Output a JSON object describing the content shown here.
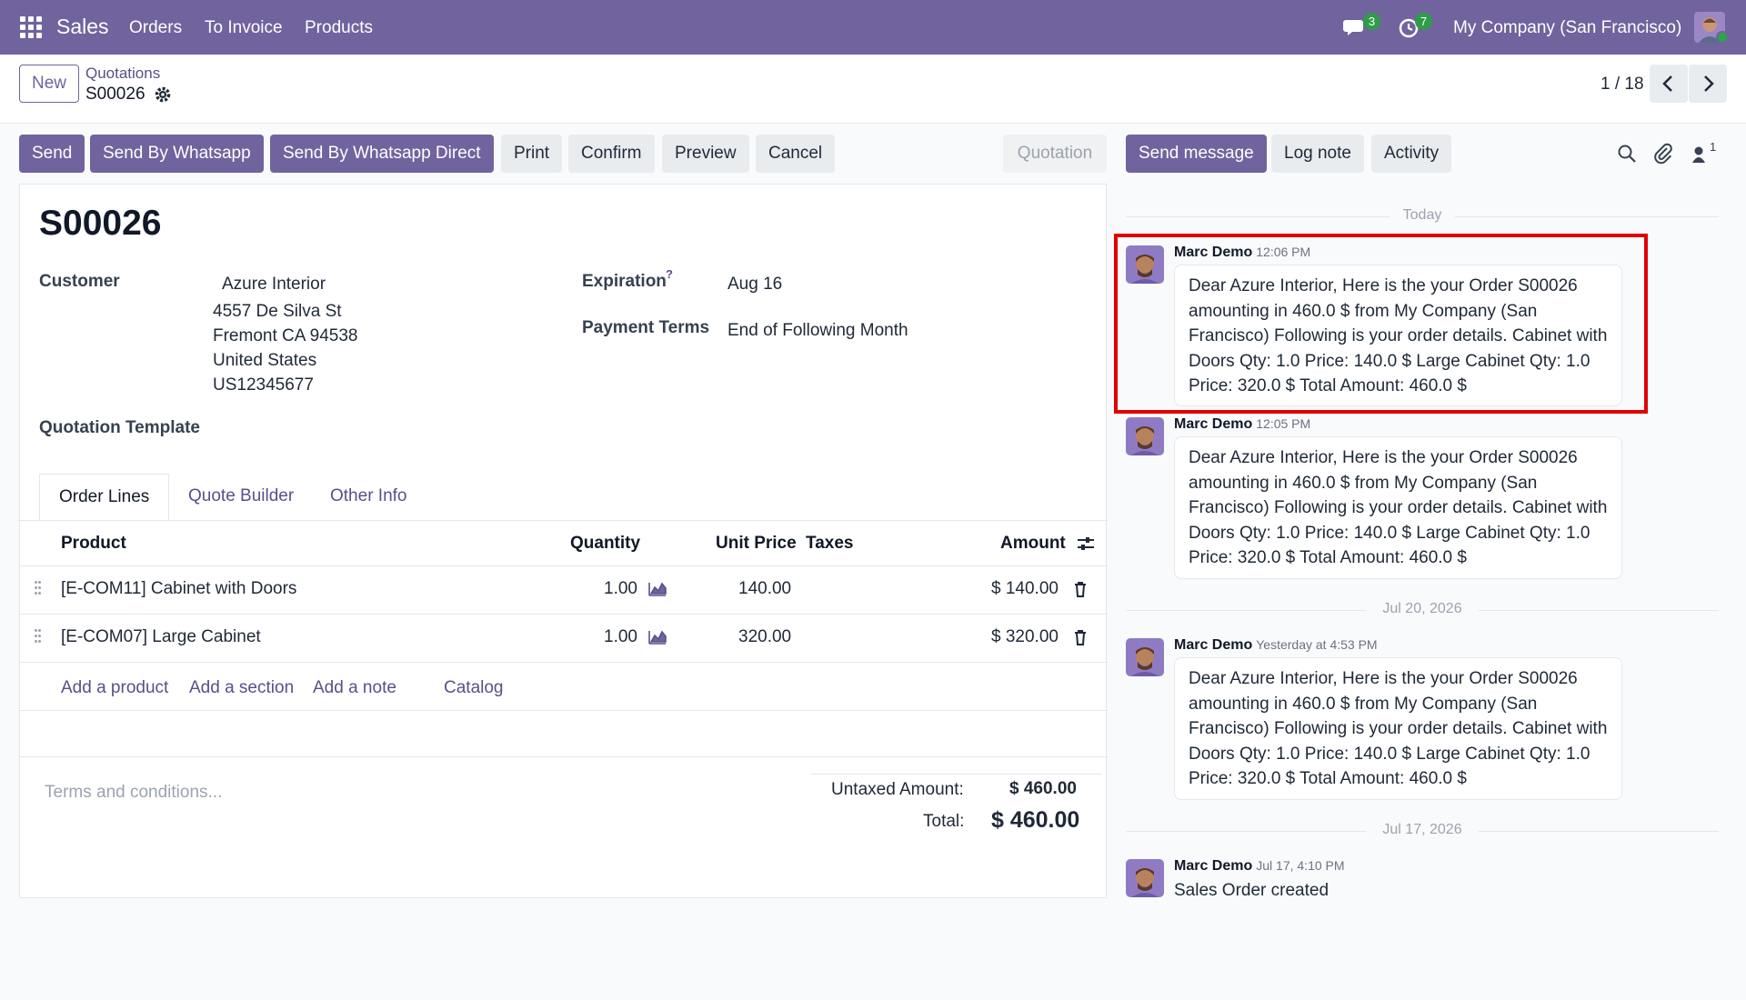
{
  "topbar": {
    "app_name": "Sales",
    "nav": [
      "Orders",
      "To Invoice",
      "Products"
    ],
    "messages_badge": "3",
    "activity_badge": "7",
    "company": "My Company (San Francisco)"
  },
  "control": {
    "new_label": "New",
    "breadcrumb_parent": "Quotations",
    "breadcrumb_current": "S00026",
    "pager": "1 / 18"
  },
  "actions": {
    "send": "Send",
    "send_whatsapp": "Send By Whatsapp",
    "send_whatsapp_direct": "Send By Whatsapp Direct",
    "print": "Print",
    "confirm": "Confirm",
    "preview": "Preview",
    "cancel": "Cancel",
    "status": "Quotation"
  },
  "form": {
    "title": "S00026",
    "customer_label": "Customer",
    "customer_name": "Azure Interior",
    "address": [
      "4557 De Silva St",
      "Fremont CA 94538",
      "United States",
      "US12345677"
    ],
    "expiration_label": "Expiration",
    "expiration_help": "?",
    "expiration_value": "Aug 16",
    "payment_terms_label": "Payment Terms",
    "payment_terms_value": "End of Following Month",
    "quotation_template_label": "Quotation Template"
  },
  "tabs": [
    "Order Lines",
    "Quote Builder",
    "Other Info"
  ],
  "order_lines": {
    "headers": {
      "product": "Product",
      "quantity": "Quantity",
      "unit_price": "Unit Price",
      "taxes": "Taxes",
      "amount": "Amount"
    },
    "rows": [
      {
        "product": "[E-COM11] Cabinet with Doors",
        "quantity": "1.00",
        "unit_price": "140.00",
        "amount": "$ 140.00"
      },
      {
        "product": "[E-COM07] Large Cabinet",
        "quantity": "1.00",
        "unit_price": "320.00",
        "amount": "$ 320.00"
      }
    ],
    "add_links": [
      "Add a product",
      "Add a section",
      "Add a note",
      "Catalog"
    ]
  },
  "totals": {
    "terms_placeholder": "Terms and conditions...",
    "untaxed_label": "Untaxed Amount:",
    "untaxed_value": "$ 460.00",
    "total_label": "Total:",
    "total_value": "$ 460.00"
  },
  "chatter": {
    "send_message": "Send message",
    "log_note": "Log note",
    "activity": "Activity",
    "followers_count": "1",
    "day_today": "Today",
    "day_2": "Jul 20, 2026",
    "day_3": "Jul 17, 2026",
    "messages": [
      {
        "author": "Marc Demo",
        "time": "12:06 PM",
        "body": "Dear Azure Interior, Here is the your Order S00026 amounting in 460.0 $ from My Company (San Francisco) Following is your order details. Cabinet with Doors Qty: 1.0 Price: 140.0 $ Large Cabinet Qty: 1.0 Price: 320.0 $ Total Amount: 460.0 $"
      },
      {
        "author": "Marc Demo",
        "time": "12:05 PM",
        "body": "Dear Azure Interior, Here is the your Order S00026 amounting in 460.0 $ from My Company (San Francisco) Following is your order details. Cabinet with Doors Qty: 1.0 Price: 140.0 $ Large Cabinet Qty: 1.0 Price: 320.0 $ Total Amount: 460.0 $"
      },
      {
        "author": "Marc Demo",
        "time": "Yesterday at 4:53 PM",
        "body": "Dear Azure Interior, Here is the your Order S00026 amounting in 460.0 $ from My Company (San Francisco) Following is your order details. Cabinet with Doors Qty: 1.0 Price: 140.0 $ Large Cabinet Qty: 1.0 Price: 320.0 $ Total Amount: 460.0 $"
      },
      {
        "author": "Marc Demo",
        "time": "Jul 17, 4:10 PM",
        "body": "Sales Order created"
      }
    ]
  },
  "colors": {
    "brand": "#71639e",
    "link": "#5b4e8a",
    "badge": "#2e9d48",
    "highlight": "#e00000"
  }
}
